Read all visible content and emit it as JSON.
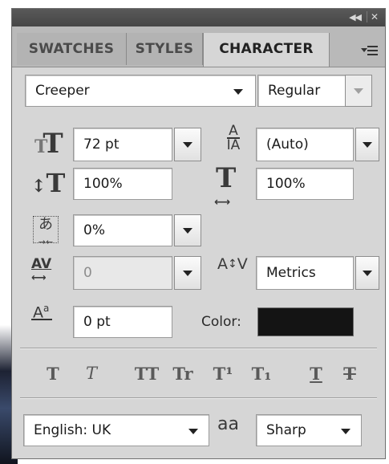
{
  "tabs": {
    "swatches": "SWATCHES",
    "styles": "STYLES",
    "character": "CHARACTER"
  },
  "font": {
    "family": "Creeper",
    "style": "Regular"
  },
  "size": {
    "value": "72 pt"
  },
  "leading": {
    "value": "(Auto)"
  },
  "vertical_scale": {
    "value": "100%"
  },
  "horizontal_scale": {
    "value": "100%"
  },
  "tsume": {
    "value": "0%"
  },
  "tracking": {
    "value": "0"
  },
  "kerning": {
    "value": "Metrics"
  },
  "baseline_shift": {
    "value": "0 pt"
  },
  "color": {
    "label": "Color:",
    "swatch": "#141414"
  },
  "style_buttons": {
    "faux_bold": "T",
    "faux_italic": "T",
    "all_caps": "TT",
    "small_caps": "Tr",
    "superscript": "T¹",
    "subscript": "T₁",
    "underline": "T",
    "strikethrough": "T"
  },
  "language": {
    "value": "English: UK"
  },
  "anti_alias": {
    "icon": "aa",
    "value": "Sharp"
  }
}
